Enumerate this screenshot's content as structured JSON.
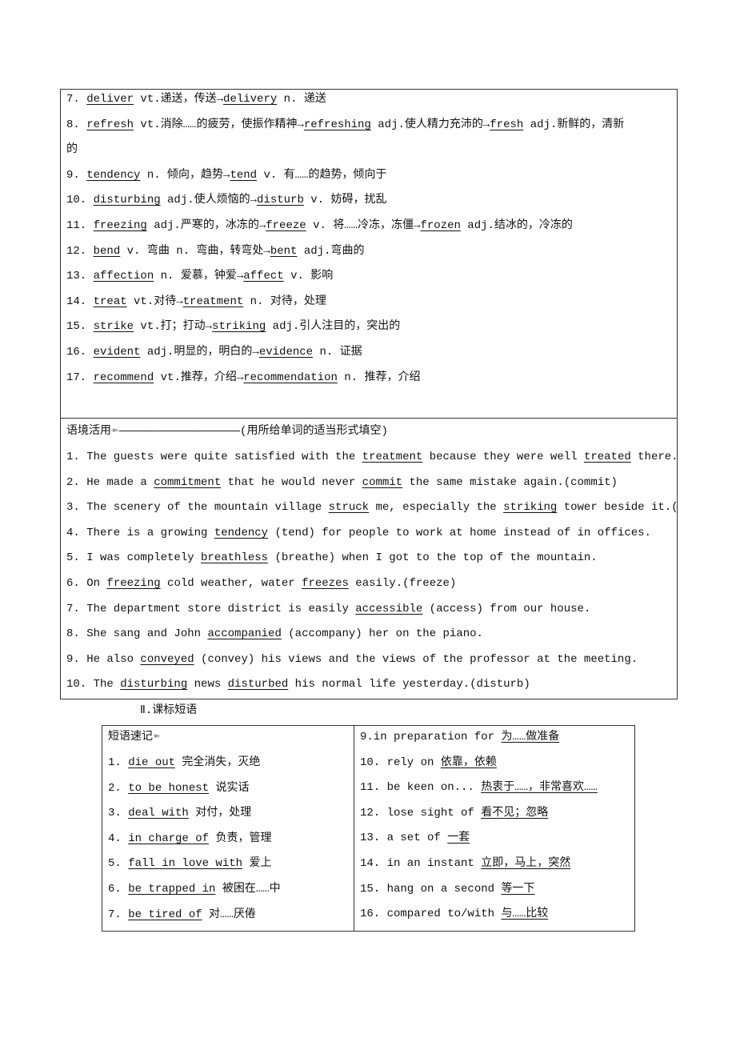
{
  "vocab_box": {
    "lines": [
      [
        {
          "t": "7. "
        },
        {
          "t": "deliver",
          "u": 1
        },
        {
          "t": " vt.递送，传送→"
        },
        {
          "t": "delivery",
          "u": 1
        },
        {
          "t": " n. 递送"
        }
      ],
      [
        {
          "t": "8. "
        },
        {
          "t": "refresh",
          "u": 1
        },
        {
          "t": " vt.消除……的疲劳，使振作精神→"
        },
        {
          "t": "refreshing",
          "u": 1
        },
        {
          "t": " adj.使人精力充沛的→"
        },
        {
          "t": "fresh",
          "u": 1
        },
        {
          "t": " adj.新鲜的，清新"
        }
      ],
      [
        {
          "t": "的"
        }
      ],
      [
        {
          "t": "9. "
        },
        {
          "t": "tendency",
          "u": 1
        },
        {
          "t": " n. 倾向，趋势→"
        },
        {
          "t": "tend",
          "u": 1
        },
        {
          "t": " v. 有……的趋势，倾向于"
        }
      ],
      [
        {
          "t": "10. "
        },
        {
          "t": "disturbing",
          "u": 1
        },
        {
          "t": " adj.使人烦恼的→"
        },
        {
          "t": "disturb",
          "u": 1
        },
        {
          "t": " v. 妨碍，扰乱"
        }
      ],
      [
        {
          "t": "11. "
        },
        {
          "t": "freezing",
          "u": 1
        },
        {
          "t": " adj.严寒的，冰冻的→"
        },
        {
          "t": "freeze",
          "u": 1
        },
        {
          "t": " v. 将……冷冻，冻僵→"
        },
        {
          "t": "frozen",
          "u": 1
        },
        {
          "t": " adj.结冰的，冷冻的"
        }
      ],
      [
        {
          "t": "12. "
        },
        {
          "t": "bend",
          "u": 1
        },
        {
          "t": " v. 弯曲 n. 弯曲，转弯处→"
        },
        {
          "t": "bent",
          "u": 1
        },
        {
          "t": " adj.弯曲的"
        }
      ],
      [
        {
          "t": "13. "
        },
        {
          "t": "affection",
          "u": 1
        },
        {
          "t": " n. 爱慕，钟爱→"
        },
        {
          "t": "affect",
          "u": 1
        },
        {
          "t": " v. 影响"
        }
      ],
      [
        {
          "t": "14. "
        },
        {
          "t": "treat",
          "u": 1
        },
        {
          "t": " vt.对待→"
        },
        {
          "t": "treatment",
          "u": 1
        },
        {
          "t": " n. 对待，处理"
        }
      ],
      [
        {
          "t": "15. "
        },
        {
          "t": "strike",
          "u": 1
        },
        {
          "t": " vt.打；打动→"
        },
        {
          "t": "striking",
          "u": 1
        },
        {
          "t": " adj.引人注目的，突出的"
        }
      ],
      [
        {
          "t": "16. "
        },
        {
          "t": "evident",
          "u": 1
        },
        {
          "t": " adj.明显的，明白的→"
        },
        {
          "t": "evidence",
          "u": 1
        },
        {
          "t": " n. 证据"
        }
      ],
      [
        {
          "t": "17. "
        },
        {
          "t": "recommend",
          "u": 1
        },
        {
          "t": " vt.推荐，介绍→"
        },
        {
          "t": "recommendation",
          "u": 1
        },
        {
          "t": " n. 推荐，介绍"
        }
      ]
    ]
  },
  "context_box": {
    "title": "语境活用",
    "title_suffix": "——————————————————(用所给单词的适当形式填空)",
    "arrow_icon": "double-arrow-icon",
    "lines": [
      [
        {
          "t": "1. The guests were quite satisfied with the "
        },
        {
          "t": "treatment",
          "u": 1
        },
        {
          "t": " because they were well "
        },
        {
          "t": "treated",
          "u": 1
        },
        {
          "t": " there.(treat)"
        }
      ],
      [
        {
          "t": "2. He made a "
        },
        {
          "t": "commitment",
          "u": 1
        },
        {
          "t": " that he would never "
        },
        {
          "t": "commit",
          "u": 1
        },
        {
          "t": " the same mistake again.(commit)"
        }
      ],
      [
        {
          "t": "3. The scenery of the mountain village "
        },
        {
          "t": "struck",
          "u": 1
        },
        {
          "t": " me, especially the "
        },
        {
          "t": "striking",
          "u": 1
        },
        {
          "t": " tower beside it.(strike)"
        }
      ],
      [
        {
          "t": "4. There is a growing "
        },
        {
          "t": "tendency",
          "u": 1
        },
        {
          "t": " (tend) for people to work at home instead of in offices."
        }
      ],
      [
        {
          "t": "5. I was completely "
        },
        {
          "t": "breathless",
          "u": 1
        },
        {
          "t": " (breathe) when I got to the top of the mountain."
        }
      ],
      [
        {
          "t": "6. On "
        },
        {
          "t": "freezing",
          "u": 1
        },
        {
          "t": " cold weather, water "
        },
        {
          "t": "freezes",
          "u": 1
        },
        {
          "t": " easily.(freeze)"
        }
      ],
      [
        {
          "t": "7. The department store district is easily "
        },
        {
          "t": "accessible",
          "u": 1
        },
        {
          "t": " (access) from our house."
        }
      ],
      [
        {
          "t": "8. She sang and John "
        },
        {
          "t": "accompanied",
          "u": 1
        },
        {
          "t": " (accompany) her on the piano."
        }
      ],
      [
        {
          "t": "9. He also "
        },
        {
          "t": "conveyed",
          "u": 1
        },
        {
          "t": " (convey) his views and the views of the professor at the meeting."
        }
      ],
      [
        {
          "t": "10. The "
        },
        {
          "t": "disturbing",
          "u": 1
        },
        {
          "t": " news "
        },
        {
          "t": "disturbed",
          "u": 1
        },
        {
          "t": " his normal life yesterday.(disturb)"
        }
      ]
    ]
  },
  "phrases_section": {
    "heading": "Ⅱ.课标短语",
    "title": "短语速记",
    "left": [
      [
        {
          "t": "1. "
        },
        {
          "t": "die out",
          "u": 1
        },
        {
          "t": " 完全消失，灭绝"
        }
      ],
      [
        {
          "t": "2. "
        },
        {
          "t": "to be honest",
          "u": 1
        },
        {
          "t": " 说实话"
        }
      ],
      [
        {
          "t": "3. "
        },
        {
          "t": "deal with",
          "u": 1
        },
        {
          "t": " 对付，处理"
        }
      ],
      [
        {
          "t": "4. "
        },
        {
          "t": "in charge of",
          "u": 1
        },
        {
          "t": " 负责，管理"
        }
      ],
      [
        {
          "t": "5. "
        },
        {
          "t": "fall in love with",
          "u": 1
        },
        {
          "t": " 爱上"
        }
      ],
      [
        {
          "t": "6. "
        },
        {
          "t": "be trapped in",
          "u": 1
        },
        {
          "t": " 被困在……中"
        }
      ],
      [
        {
          "t": "7. "
        },
        {
          "t": "be tired of",
          "u": 1
        },
        {
          "t": " 对……厌倦"
        }
      ]
    ],
    "right": [
      [
        {
          "t": "9.in preparation for "
        },
        {
          "t": "为……做准备",
          "u": 1
        }
      ],
      [
        {
          "t": "10. rely on "
        },
        {
          "t": "依靠，依赖",
          "u": 1
        }
      ],
      [
        {
          "t": "11. be keen on... "
        },
        {
          "t": "热衷于……，非常喜欢……",
          "u": 1
        }
      ],
      [
        {
          "t": "12. lose sight of "
        },
        {
          "t": "看不见；忽略",
          "u": 1
        }
      ],
      [
        {
          "t": "13. a set of "
        },
        {
          "t": "一套",
          "u": 1
        }
      ],
      [
        {
          "t": "14. in an instant "
        },
        {
          "t": "立即，马上，突然",
          "u": 1
        }
      ],
      [
        {
          "t": "15. hang on a second "
        },
        {
          "t": "等一下",
          "u": 1
        }
      ],
      [
        {
          "t": "16. compared to/with "
        },
        {
          "t": "与……比较",
          "u": 1
        }
      ]
    ]
  }
}
